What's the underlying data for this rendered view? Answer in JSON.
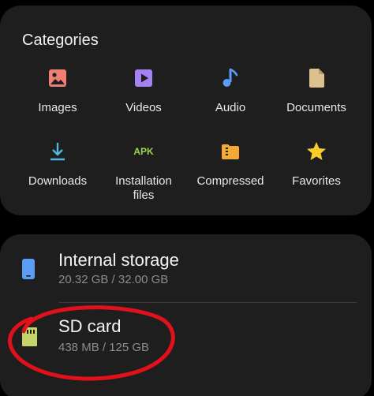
{
  "categories": {
    "title": "Categories",
    "items": [
      {
        "label": "Images",
        "icon": "image-icon",
        "color": "#f07f73"
      },
      {
        "label": "Videos",
        "icon": "video-icon",
        "color": "#a582f2"
      },
      {
        "label": "Audio",
        "icon": "music-note-icon",
        "color": "#5b9df5"
      },
      {
        "label": "Documents",
        "icon": "document-icon",
        "color": "#dcc08f"
      },
      {
        "label": "Downloads",
        "icon": "download-icon",
        "color": "#52b9dc"
      },
      {
        "label": "Installation\nfiles",
        "icon": "apk-icon",
        "icon_text": "APK",
        "color": "#9dd34f"
      },
      {
        "label": "Compressed",
        "icon": "compressed-folder-icon",
        "color": "#f3a934"
      },
      {
        "label": "Favorites",
        "icon": "star-icon",
        "color": "#f6cd2b"
      }
    ]
  },
  "storage": {
    "internal": {
      "name": "Internal storage",
      "size": "20.32 GB / 32.00 GB",
      "icon": "phone-icon",
      "color": "#5b9df5"
    },
    "sd_card": {
      "name": "SD card",
      "size": "438 MB / 125 GB",
      "icon": "sd-card-icon",
      "color": "#c5d36a"
    }
  },
  "annotation_color": "#e0111b"
}
